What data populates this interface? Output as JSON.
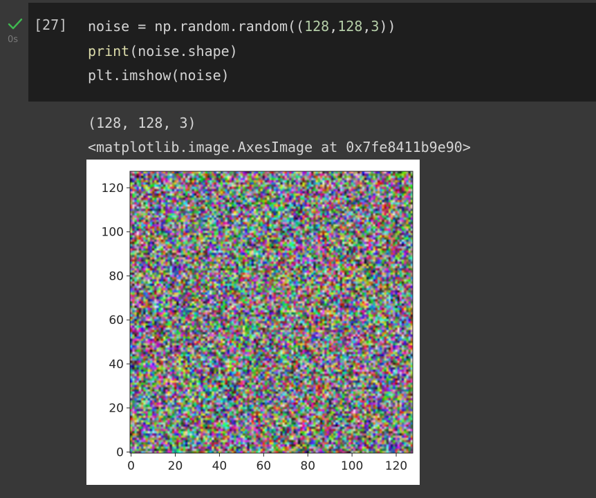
{
  "cell": {
    "status_icon": "checkmark-icon",
    "exec_time": "0s",
    "execution_count": "[27]",
    "code": {
      "line1": {
        "p1": "noise = np.random.random((",
        "n1": "128",
        "c1": ",",
        "n2": "128",
        "c2": ",",
        "n3": "3",
        "p2": "))"
      },
      "line2": {
        "fn": "print",
        "rest": "(noise.shape)"
      },
      "line3": "plt.imshow(noise)"
    }
  },
  "output": {
    "stdout": "(128, 128, 3)",
    "repr": "<matplotlib.image.AxesImage at 0x7fe8411b9e90>"
  },
  "chart_data": {
    "type": "heatmap",
    "description_type": "imshow",
    "image_shape": [
      128,
      128,
      3
    ],
    "xticks": [
      0,
      20,
      40,
      60,
      80,
      100,
      120
    ],
    "yticks": [
      0,
      20,
      40,
      60,
      80,
      100,
      120
    ],
    "xlim": [
      -0.5,
      127.5
    ],
    "ylim": [
      127.5,
      -0.5
    ],
    "pixel_values": "uniform random in [0, 1) per RGB channel"
  }
}
